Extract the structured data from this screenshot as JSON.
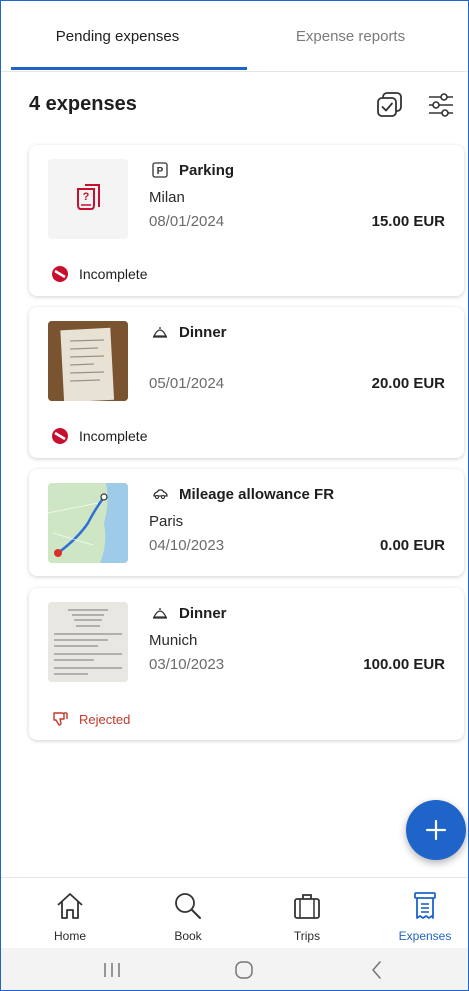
{
  "tabs": [
    {
      "label": "Pending expenses",
      "active": true
    },
    {
      "label": "Expense reports",
      "active": false
    }
  ],
  "header": {
    "count_label": "4 expenses",
    "icons": [
      "select-all-icon",
      "filter-sliders-icon"
    ]
  },
  "colors": {
    "accent": "#1f64c8",
    "incomplete": "#c8102e",
    "rejected": "#c0392b"
  },
  "expenses": [
    {
      "category": "Parking",
      "category_icon": "parking-icon",
      "city": "Milan",
      "date": "08/01/2024",
      "amount": "15.00 EUR",
      "thumbnail": "missing-receipt-icon",
      "status": "Incomplete"
    },
    {
      "category": "Dinner",
      "category_icon": "cloche-icon",
      "city": "",
      "date": "05/01/2024",
      "amount": "20.00 EUR",
      "thumbnail": "receipt-photo",
      "status": "Incomplete"
    },
    {
      "category": "Mileage allowance FR",
      "category_icon": "car-icon",
      "city": "Paris",
      "date": "04/10/2023",
      "amount": "0.00 EUR",
      "thumbnail": "route-map",
      "status": ""
    },
    {
      "category": "Dinner",
      "category_icon": "cloche-icon",
      "city": "Munich",
      "date": "03/10/2023",
      "amount": "100.00 EUR",
      "thumbnail": "receipt-scan",
      "status": "Rejected"
    }
  ],
  "fab": {
    "icon": "plus-icon"
  },
  "bottom_nav": [
    {
      "label": "Home",
      "icon": "home-icon",
      "active": false
    },
    {
      "label": "Book",
      "icon": "search-icon",
      "active": false
    },
    {
      "label": "Trips",
      "icon": "suitcase-icon",
      "active": false
    },
    {
      "label": "Expenses",
      "icon": "receipt-icon",
      "active": true
    }
  ],
  "system_nav": [
    "recent-apps-icon",
    "home-circle-icon",
    "back-icon"
  ]
}
